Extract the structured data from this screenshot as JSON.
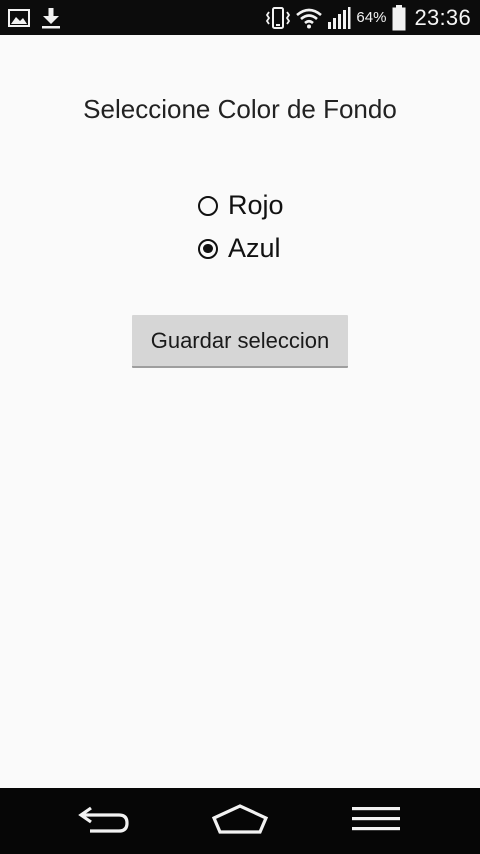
{
  "status_bar": {
    "left_icons": [
      "image-icon",
      "download-icon"
    ],
    "right_icons": [
      "vibrate-icon",
      "wifi-icon",
      "signal-icon"
    ],
    "battery_percent": "64%",
    "battery_icon": "battery-icon",
    "time": "23:36",
    "background": "#0c0c0c"
  },
  "screen": {
    "title": "Seleccione Color de Fondo",
    "background": "#fafafa"
  },
  "radio_group": {
    "selected": "azul",
    "options": [
      {
        "id": "rojo",
        "label": "Rojo",
        "checked": false
      },
      {
        "id": "azul",
        "label": "Azul",
        "checked": true
      }
    ]
  },
  "save_button": {
    "label": "Guardar seleccion",
    "background": "#d6d6d6"
  },
  "nav_bar": {
    "buttons": [
      "back-icon",
      "home-icon",
      "menu-icon"
    ],
    "background": "#060606"
  }
}
